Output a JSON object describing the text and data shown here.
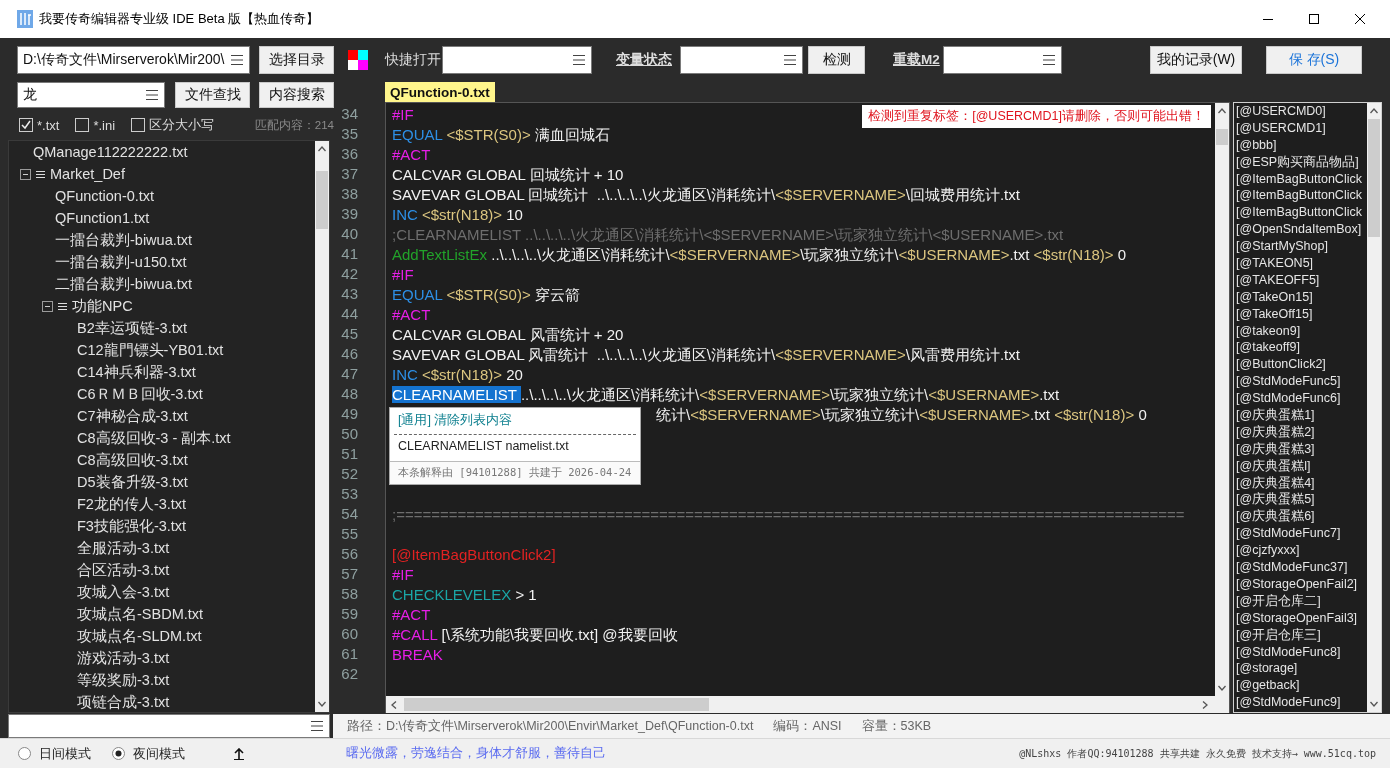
{
  "window": {
    "title": "我要传奇编辑器专业级 IDE Beta 版【热血传奇】"
  },
  "toolbar": [
    {
      "kind": "field",
      "value": "D:\\传奇文件\\Mirserverok\\Mir200\\"
    },
    {
      "kind": "button",
      "label": "选择目录",
      "primary": false
    },
    {
      "kind": "palette"
    },
    {
      "kind": "label",
      "text": "快捷打开"
    },
    {
      "kind": "field"
    },
    {
      "kind": "link",
      "text": "变量状态"
    },
    {
      "kind": "field"
    },
    {
      "kind": "button",
      "label": "检测",
      "primary": false
    },
    {
      "kind": "link",
      "text": "重载M2"
    },
    {
      "kind": "field"
    },
    {
      "kind": "button",
      "label": "我的记录(W)",
      "primary": false
    },
    {
      "kind": "button",
      "label": "保 存(S)",
      "primary": true
    }
  ],
  "search": {
    "field": {
      "value": "龙"
    },
    "buttons": [
      "文件查找",
      "内容搜索"
    ],
    "filters": [
      {
        "label": "*.txt",
        "checked": true
      },
      {
        "label": "*.ini",
        "checked": false
      },
      {
        "label": "区分大小写",
        "checked": false
      }
    ],
    "match_count": "匹配内容：214"
  },
  "tree": [
    {
      "label": "QManage112222222.txt",
      "kind": "file"
    },
    {
      "label": "Market_Def",
      "kind": "folder",
      "expanded": true,
      "children": [
        {
          "label": "QFunction-0.txt",
          "kind": "file"
        },
        {
          "label": "QFunction1.txt",
          "kind": "file"
        },
        {
          "label": "一擂台裁判-biwua.txt",
          "kind": "file"
        },
        {
          "label": "一擂台裁判-u150.txt",
          "kind": "file"
        },
        {
          "label": "二擂台裁判-biwua.txt",
          "kind": "file"
        },
        {
          "label": "功能NPC",
          "kind": "folder",
          "expanded": true,
          "children": [
            {
              "label": "B2幸运项链-3.txt",
              "kind": "file"
            },
            {
              "label": "C12龍門镖头-YB01.txt",
              "kind": "file"
            },
            {
              "label": "C14神兵利器-3.txt",
              "kind": "file"
            },
            {
              "label": "C6ＲＭＢ回收-3.txt",
              "kind": "file"
            },
            {
              "label": "C7神秘合成-3.txt",
              "kind": "file"
            },
            {
              "label": "C8高级回收-3 - 副本.txt",
              "kind": "file"
            },
            {
              "label": "C8高级回收-3.txt",
              "kind": "file"
            },
            {
              "label": "D5装备升级-3.txt",
              "kind": "file"
            },
            {
              "label": "F2龙的传人-3.txt",
              "kind": "file"
            },
            {
              "label": "F3技能强化-3.txt",
              "kind": "file"
            },
            {
              "label": "全服活动-3.txt",
              "kind": "file"
            },
            {
              "label": "合区活动-3.txt",
              "kind": "file"
            },
            {
              "label": "攻城入会-3.txt",
              "kind": "file"
            },
            {
              "label": "攻城点名-SBDM.txt",
              "kind": "file"
            },
            {
              "label": "攻城点名-SLDM.txt",
              "kind": "file"
            },
            {
              "label": "游戏活动-3.txt",
              "kind": "file"
            },
            {
              "label": "等级奖励-3.txt",
              "kind": "file"
            },
            {
              "label": "项链合成-3.txt",
              "kind": "file"
            }
          ]
        }
      ]
    }
  ],
  "editor": {
    "tab": {
      "label": "QFunction-0.txt",
      "selected": true
    },
    "warning": "检测到重复标签：[@USERCMD1]请删除，否则可能出错！",
    "lines": [
      {
        "number": "34",
        "covered": false,
        "tokens": [
          {
            "kind": "directive",
            "text": "#IF"
          }
        ]
      },
      {
        "number": "35",
        "covered": false,
        "tokens": [
          {
            "kind": "command",
            "text": "EQUAL "
          },
          {
            "kind": "variable",
            "text": "<$STR(S0)>"
          },
          {
            "kind": "plain",
            "text": " 满血回城石"
          }
        ]
      },
      {
        "number": "36",
        "covered": false,
        "tokens": [
          {
            "kind": "directive",
            "text": "#ACT"
          }
        ]
      },
      {
        "number": "37",
        "covered": false,
        "tokens": [
          {
            "kind": "plain",
            "text": "CALCVAR GLOBAL 回城统计 + 10"
          }
        ]
      },
      {
        "number": "38",
        "covered": false,
        "tokens": [
          {
            "kind": "plain",
            "text": "SAVEVAR GLOBAL 回城统计  ..\\..\\..\\..\\火龙通区\\消耗统计\\"
          },
          {
            "kind": "variable",
            "text": "<$SERVERNAME>"
          },
          {
            "kind": "plain",
            "text": "\\回城费用统计.txt"
          }
        ]
      },
      {
        "number": "39",
        "covered": false,
        "tokens": [
          {
            "kind": "command",
            "text": "INC "
          },
          {
            "kind": "variable",
            "text": "<$str(N18)>"
          },
          {
            "kind": "plain",
            "text": " 10"
          }
        ]
      },
      {
        "number": "40",
        "covered": false,
        "tokens": [
          {
            "kind": "comment",
            "text": ";CLEARNAMELIST ..\\..\\..\\..\\火龙通区\\消耗统计\\<$SERVERNAME>\\玩家独立统计\\<$USERNAME>.txt"
          }
        ]
      },
      {
        "number": "41",
        "covered": false,
        "tokens": [
          {
            "kind": "function",
            "text": "AddTextListEx"
          },
          {
            "kind": "plain",
            "text": " ..\\..\\..\\..\\火龙通区\\消耗统计\\"
          },
          {
            "kind": "variable",
            "text": "<$SERVERNAME>"
          },
          {
            "kind": "plain",
            "text": "\\玩家独立统计\\"
          },
          {
            "kind": "variable",
            "text": "<$USERNAME>"
          },
          {
            "kind": "plain",
            "text": ".txt "
          },
          {
            "kind": "variable",
            "text": "<$str(N18)>"
          },
          {
            "kind": "plain",
            "text": " 0"
          }
        ]
      },
      {
        "number": "42",
        "covered": false,
        "tokens": [
          {
            "kind": "directive",
            "text": "#IF"
          }
        ]
      },
      {
        "number": "43",
        "covered": false,
        "tokens": [
          {
            "kind": "command",
            "text": "EQUAL "
          },
          {
            "kind": "variable",
            "text": "<$STR(S0)>"
          },
          {
            "kind": "plain",
            "text": " 穿云箭"
          }
        ]
      },
      {
        "number": "44",
        "covered": false,
        "tokens": [
          {
            "kind": "directive",
            "text": "#ACT"
          }
        ]
      },
      {
        "number": "45",
        "covered": false,
        "tokens": [
          {
            "kind": "plain",
            "text": "CALCVAR GLOBAL 风雷统计 + 20"
          }
        ]
      },
      {
        "number": "46",
        "covered": false,
        "tokens": [
          {
            "kind": "plain",
            "text": "SAVEVAR GLOBAL 风雷统计  ..\\..\\..\\..\\火龙通区\\消耗统计\\"
          },
          {
            "kind": "variable",
            "text": "<$SERVERNAME>"
          },
          {
            "kind": "plain",
            "text": "\\风雷费用统计.txt"
          }
        ]
      },
      {
        "number": "47",
        "covered": false,
        "tokens": [
          {
            "kind": "command",
            "text": "INC "
          },
          {
            "kind": "variable",
            "text": "<$str(N18)>"
          },
          {
            "kind": "plain",
            "text": " 20"
          }
        ]
      },
      {
        "number": "48",
        "covered": false,
        "tokens": [
          {
            "kind": "selection",
            "text": "CLEARNAMELIST "
          },
          {
            "kind": "plain",
            "text": "..\\..\\..\\..\\火龙通区\\消耗统计\\"
          },
          {
            "kind": "variable",
            "text": "<$SERVERNAME>"
          },
          {
            "kind": "plain",
            "text": "\\玩家独立统计\\"
          },
          {
            "kind": "variable",
            "text": "<$USERNAME>"
          },
          {
            "kind": "plain",
            "text": ".txt"
          }
        ]
      },
      {
        "number": "49",
        "covered": true,
        "tokens": [
          {
            "kind": "plain",
            "text": "统计\\"
          },
          {
            "kind": "variable",
            "text": "<$SERVERNAME>"
          },
          {
            "kind": "plain",
            "text": "\\玩家独立统计\\"
          },
          {
            "kind": "variable",
            "text": "<$USERNAME>"
          },
          {
            "kind": "plain",
            "text": ".txt "
          },
          {
            "kind": "variable",
            "text": "<$str(N18)>"
          },
          {
            "kind": "plain",
            "text": " 0"
          }
        ]
      },
      {
        "number": "50"
      },
      {
        "number": "51"
      },
      {
        "number": "52"
      },
      {
        "number": "53"
      },
      {
        "number": "54",
        "covered": false,
        "tokens": [
          {
            "kind": "comment",
            "text": ";=========================================================================================="
          }
        ]
      },
      {
        "number": "55"
      },
      {
        "number": "56",
        "covered": false,
        "tokens": [
          {
            "kind": "label",
            "text": "[@ItemBagButtonClick2]"
          }
        ]
      },
      {
        "number": "57",
        "covered": false,
        "tokens": [
          {
            "kind": "directive",
            "text": "#IF"
          }
        ]
      },
      {
        "number": "58",
        "covered": false,
        "tokens": [
          {
            "kind": "condition",
            "text": "CHECKLEVELEX"
          },
          {
            "kind": "plain",
            "text": " > 1"
          }
        ]
      },
      {
        "number": "59",
        "covered": false,
        "tokens": [
          {
            "kind": "directive",
            "text": "#ACT"
          }
        ]
      },
      {
        "number": "60",
        "covered": false,
        "tokens": [
          {
            "kind": "directive",
            "text": "#CALL"
          },
          {
            "kind": "plain",
            "text": " [\\系统功能\\我要回收.txt] @我要回收"
          }
        ]
      },
      {
        "number": "61",
        "covered": false,
        "tokens": [
          {
            "kind": "directive",
            "text": "BREAK"
          }
        ]
      },
      {
        "number": "62"
      }
    ],
    "tooltip": {
      "title": "[通用] 清除列表内容",
      "usage": "CLEARNAMELIST namelist.txt",
      "credit": "本条解释由 [94101288] 共建于 2026-04-24"
    }
  },
  "labels": [
    "[@USERCMD0]",
    "[@USERCMD1]",
    "[@bbb]",
    "[@ESP购买商品物品]",
    "[@ItemBagButtonClick",
    "[@ItemBagButtonClick",
    "[@ItemBagButtonClick",
    "[@OpenSndaItemBox]",
    "[@StartMyShop]",
    "[@TAKEON5]",
    "[@TAKEOFF5]",
    "[@TakeOn15]",
    "[@TakeOff15]",
    "[@takeon9]",
    "[@takeoff9]",
    "[@ButtonClick2]",
    "[@StdModeFunc5]",
    "[@StdModeFunc6]",
    "[@庆典蛋糕1]",
    "[@庆典蛋糕2]",
    "[@庆典蛋糕3]",
    "[@庆典蛋糕l]",
    "[@庆典蛋糕4]",
    "[@庆典蛋糕5]",
    "[@庆典蛋糕6]",
    "[@StdModeFunc7]",
    "[@cjzfyxxx]",
    "[@StdModeFunc37]",
    "[@StorageOpenFail2]",
    "[@开启仓库二]",
    "[@StorageOpenFail3]",
    "[@开启仓库三]",
    "[@StdModeFunc8]",
    "[@storage]",
    "[@getback]",
    "[@StdModeFunc9]"
  ],
  "status_bar": {
    "path": "路径：D:\\传奇文件\\Mirserverok\\Mir200\\Envir\\Market_Def\\QFunction-0.txt",
    "encoding": "编码：ANSI",
    "size": "容量：53KB"
  },
  "footer": {
    "modes": [
      {
        "label": "日间模式",
        "selected": false
      },
      {
        "label": "夜间模式",
        "selected": true
      }
    ],
    "slogan": "曙光微露，劳逸结合，身体才舒服，善待自己",
    "credits": "@NLshxs 作者QQ:94101288 共享共建 永久免费 技术支持→ www.51cq.top"
  }
}
